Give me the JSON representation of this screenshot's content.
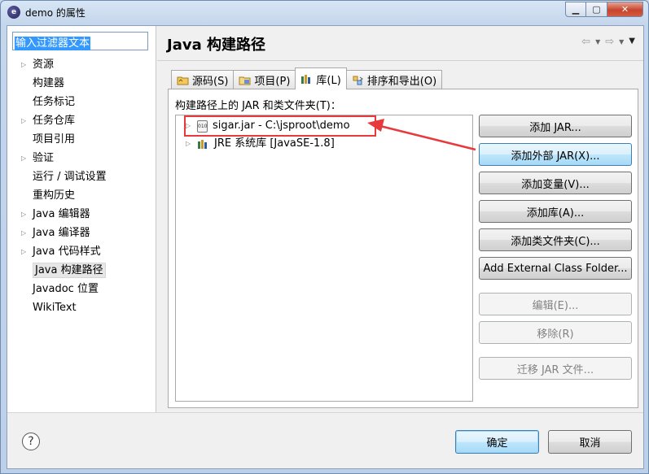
{
  "window": {
    "title": "demo 的属性",
    "app_icon_glyph": "e"
  },
  "filter": {
    "value": "输入过滤器文本"
  },
  "left_tree": [
    {
      "label": "资源",
      "expandable": true
    },
    {
      "label": "构建器",
      "expandable": false
    },
    {
      "label": "任务标记",
      "expandable": false
    },
    {
      "label": "任务仓库",
      "expandable": true
    },
    {
      "label": "项目引用",
      "expandable": false
    },
    {
      "label": "验证",
      "expandable": true
    },
    {
      "label": "运行 / 调试设置",
      "expandable": false
    },
    {
      "label": "重构历史",
      "expandable": false
    },
    {
      "label": "Java 编辑器",
      "expandable": true
    },
    {
      "label": "Java 编译器",
      "expandable": true
    },
    {
      "label": "Java 代码样式",
      "expandable": true
    },
    {
      "label": "Java 构建路径",
      "expandable": false,
      "selected": true
    },
    {
      "label": "Javadoc 位置",
      "expandable": false
    },
    {
      "label": "WikiText",
      "expandable": false
    }
  ],
  "page": {
    "title": "Java 构建路径"
  },
  "tabs": [
    {
      "label": "源码(S)",
      "icon": "folder-source-icon"
    },
    {
      "label": "项目(P)",
      "icon": "project-icon"
    },
    {
      "label": "库(L)",
      "icon": "library-icon",
      "active": true
    },
    {
      "label": "排序和导出(O)",
      "icon": "order-export-icon"
    }
  ],
  "libraries": {
    "label": "构建路径上的 JAR 和类文件夹(T)：",
    "items": [
      {
        "label": "sigar.jar  -  C:\\jsproot\\demo",
        "icon": "jar-icon"
      },
      {
        "label": "JRE 系统库 [JavaSE-1.8]",
        "icon": "library-icon"
      }
    ]
  },
  "buttons": {
    "add_jar": "添加 JAR...",
    "add_external_jar": "添加外部 JAR(X)...",
    "add_variable": "添加变量(V)...",
    "add_library": "添加库(A)...",
    "add_class_folder": "添加类文件夹(C)...",
    "add_external_class_folder": "Add External Class Folder...",
    "edit": "编辑(E)...",
    "remove": "移除(R)",
    "migrate_jar": "迁移 JAR 文件..."
  },
  "footer": {
    "help": "?",
    "ok": "确定",
    "cancel": "取消"
  },
  "colors": {
    "highlight_red": "#e8393c",
    "selection_blue": "#3399ff"
  }
}
